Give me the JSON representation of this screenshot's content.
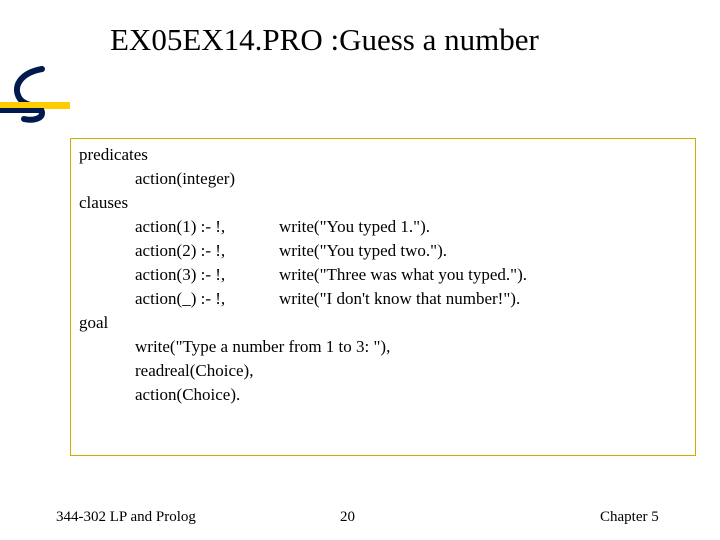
{
  "title": "EX05EX14.PRO :Guess a number",
  "code": {
    "predicates_kw": "predicates",
    "predicates_decl": "action(integer)",
    "clauses_kw": "clauses",
    "clauses": [
      {
        "head": "action(1) :- !,",
        "body": "write(\"You typed 1.\")."
      },
      {
        "head": "action(2) :- !,",
        "body": "write(\"You typed two.\")."
      },
      {
        "head": "action(3) :- !,",
        "body": "write(\"Three was what you typed.\")."
      },
      {
        "head": "action(_) :- !,",
        "body": "write(\"I don't know that number!\")."
      }
    ],
    "goal_kw": "goal",
    "goal_lines": [
      "write(\"Type a number from 1 to 3: \"),",
      "readreal(Choice),",
      "action(Choice)."
    ]
  },
  "footer": {
    "left": "344-302 LP and Prolog",
    "center": "20",
    "right": "Chapter 5"
  }
}
